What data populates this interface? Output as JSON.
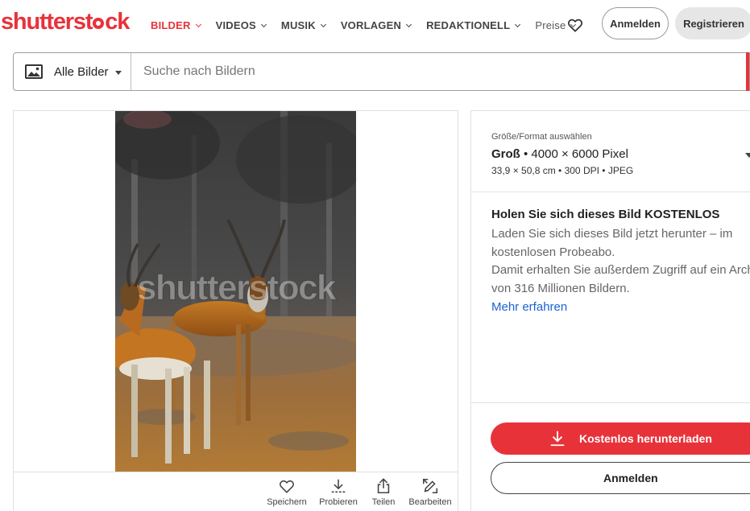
{
  "brand": {
    "logo_part1": "shutterst",
    "logo_part2": "ck",
    "accent_color": "#e8323a"
  },
  "nav": {
    "items": [
      {
        "label": "BILDER",
        "active": true
      },
      {
        "label": "VIDEOS"
      },
      {
        "label": "MUSIK"
      },
      {
        "label": "VORLAGEN"
      },
      {
        "label": "REDAKTIONELL"
      },
      {
        "label": "Preise"
      }
    ],
    "login_label": "Anmelden",
    "register_label": "Registrieren"
  },
  "search": {
    "category_label": "Alle Bilder",
    "placeholder": "Suche nach Bildern",
    "value": ""
  },
  "image": {
    "watermark": "shutterstock",
    "actions": [
      {
        "label": "Speichern",
        "icon": "heart-icon"
      },
      {
        "label": "Probieren",
        "icon": "download-icon"
      },
      {
        "label": "Teilen",
        "icon": "share-icon"
      },
      {
        "label": "Bearbeiten",
        "icon": "edit-icon"
      }
    ]
  },
  "size_select": {
    "label": "Größe/Format auswählen",
    "size_name": "Groß",
    "dimensions": " • 4000 × 6000 Pixel",
    "meta": "33,9 × 50,8 cm • 300 DPI • JPEG"
  },
  "offer": {
    "title": "Holen Sie sich dieses Bild KOSTENLOS",
    "line1": "Laden Sie sich dieses Bild jetzt herunter – im",
    "line2": "kostenlosen Probeabo.",
    "line3": "Damit erhalten Sie außerdem Zugriff auf ein Arch",
    "line4": "von 316 Millionen Bildern.",
    "link": "Mehr erfahren"
  },
  "cta": {
    "download_label": "Kostenlos herunterladen",
    "login_label": "Anmelden"
  }
}
